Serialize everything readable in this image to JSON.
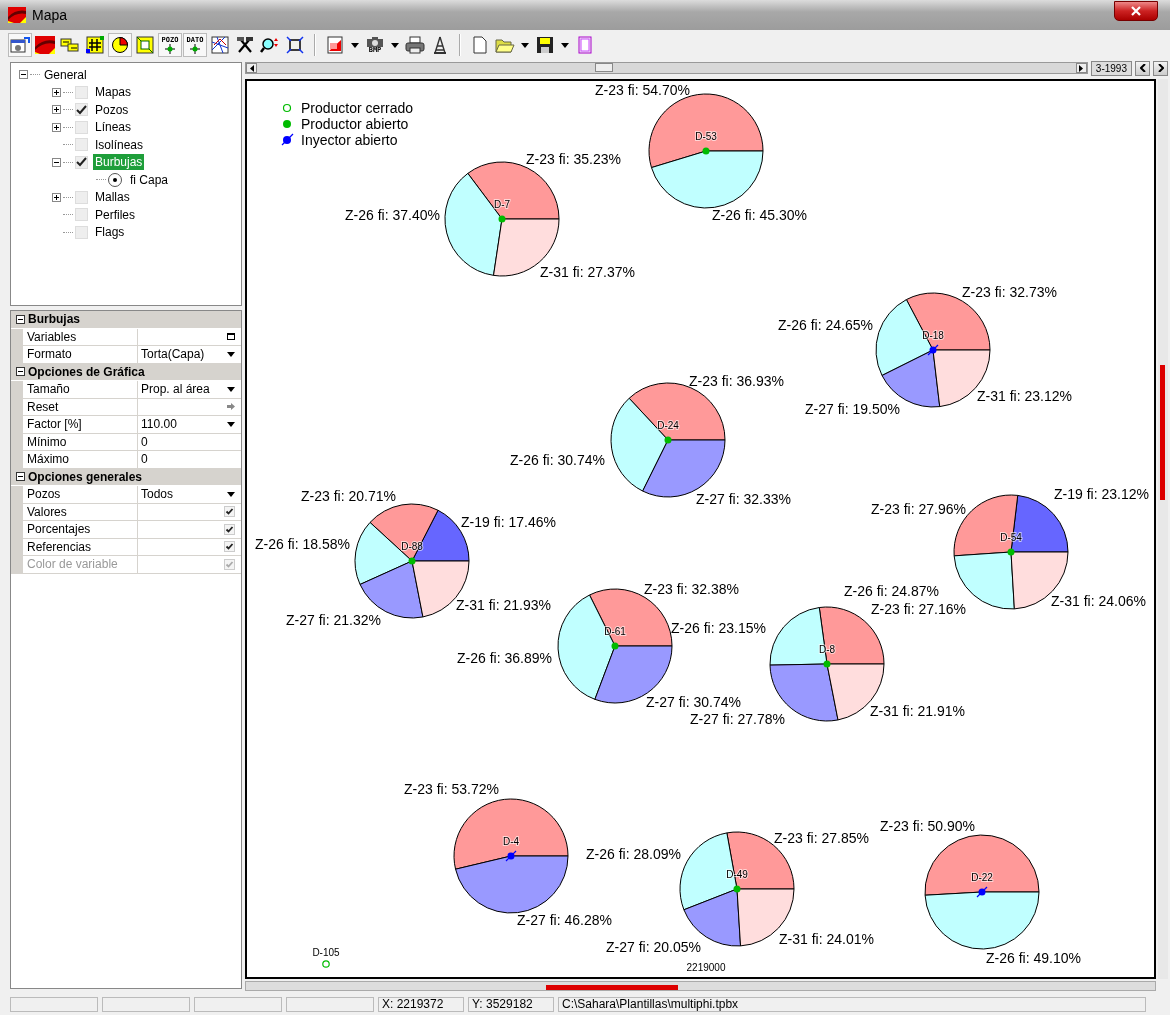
{
  "window": {
    "title": "Mapa"
  },
  "toolbar": {
    "groups": [
      [
        {
          "kind": "properties",
          "pressed": true
        },
        {
          "kind": "layers",
          "pressed": false
        },
        {
          "kind": "swap",
          "pressed": false
        },
        {
          "kind": "grid",
          "pressed": false
        },
        {
          "kind": "pie",
          "pressed": true
        },
        {
          "kind": "fit",
          "pressed": false
        },
        {
          "kind": "well",
          "caption": "POZO",
          "pressed": true
        },
        {
          "kind": "well",
          "caption": "DATO",
          "pressed": true
        },
        {
          "kind": "network",
          "pressed": false
        },
        {
          "kind": "tools",
          "pressed": false
        },
        {
          "kind": "zoom",
          "pressed": false
        },
        {
          "kind": "fullscreen",
          "pressed": false
        }
      ],
      [
        {
          "kind": "export",
          "dropdown": true,
          "pressed": false
        },
        {
          "kind": "camera",
          "caption": "BMP",
          "dropdown": true,
          "pressed": false
        },
        {
          "kind": "printer",
          "pressed": false
        },
        {
          "kind": "derrick",
          "pressed": false
        }
      ],
      [
        {
          "kind": "new",
          "pressed": false
        },
        {
          "kind": "open",
          "dropdown": true,
          "pressed": false
        },
        {
          "kind": "save",
          "dropdown": true,
          "pressed": false
        },
        {
          "kind": "book",
          "pressed": false
        }
      ]
    ]
  },
  "tree": {
    "items": [
      {
        "label": "General",
        "expanded": true,
        "selected": false,
        "children": [
          {
            "label": "Mapas",
            "kind": "checkbox",
            "checked": false,
            "expanded": false,
            "selected": false
          },
          {
            "label": "Pozos",
            "kind": "checkbox",
            "checked": true,
            "expanded": false,
            "selected": false
          },
          {
            "label": "Líneas",
            "kind": "checkbox",
            "checked": false,
            "expanded": false,
            "selected": false
          },
          {
            "label": "Isolíneas",
            "kind": "checkbox",
            "checked": false,
            "selected": false
          },
          {
            "label": "Burbujas",
            "kind": "checkbox",
            "checked": true,
            "expanded": true,
            "selected": true,
            "children": [
              {
                "label": "fi Capa",
                "kind": "radio",
                "checked": true,
                "selected": false
              }
            ]
          },
          {
            "label": "Mallas",
            "kind": "checkbox",
            "checked": false,
            "expanded": false,
            "selected": false
          },
          {
            "label": "Perfiles",
            "kind": "checkbox",
            "checked": false,
            "selected": false
          },
          {
            "label": "Flags",
            "kind": "checkbox",
            "checked": false,
            "selected": false
          }
        ]
      }
    ]
  },
  "properties": {
    "sections": [
      {
        "title": "Burbujas",
        "expanded": true,
        "rows": [
          {
            "name": "Variables",
            "kind": "dialog",
            "disabled": false
          },
          {
            "name": "Formato",
            "value": "Torta(Capa)",
            "kind": "dropdown",
            "disabled": false
          }
        ]
      },
      {
        "title": "Opciones de Gráfica",
        "expanded": true,
        "rows": [
          {
            "name": "Tamaño",
            "value": "Prop. al área",
            "kind": "dropdown",
            "disabled": false
          },
          {
            "name": "Reset",
            "kind": "action",
            "disabled": false
          },
          {
            "name": "Factor [%]",
            "value": "110.00",
            "kind": "dropdown",
            "disabled": false
          },
          {
            "name": "Mínimo",
            "value": "0",
            "kind": "text",
            "disabled": false
          },
          {
            "name": "Máximo",
            "value": "0",
            "kind": "text",
            "disabled": false
          }
        ]
      },
      {
        "title": "Opciones generales",
        "expanded": true,
        "rows": [
          {
            "name": "Pozos",
            "value": "Todos",
            "kind": "dropdown",
            "disabled": false
          },
          {
            "name": "Valores",
            "kind": "checkbox",
            "checked": true,
            "disabled": false
          },
          {
            "name": "Porcentajes",
            "kind": "checkbox",
            "checked": true,
            "disabled": false
          },
          {
            "name": "Referencias",
            "kind": "checkbox",
            "checked": true,
            "disabled": false
          },
          {
            "name": "Color de variable",
            "kind": "checkbox",
            "checked": true,
            "disabled": true
          }
        ]
      }
    ]
  },
  "map": {
    "date": "3-1993",
    "legend": [
      {
        "kind": "producer_closed",
        "label": "Productor cerrado"
      },
      {
        "kind": "producer_open",
        "label": "Productor abierto"
      },
      {
        "kind": "injector_open",
        "label": "Inyector abierto"
      }
    ],
    "wells": [
      {
        "name": "D-53",
        "kind": "producer_open",
        "slices": [
          {
            "layer": "Z-23 fi:",
            "value": "54.70%",
            "color": "#ff9999"
          },
          {
            "layer": "Z-26 fi:",
            "value": "45.30%",
            "color": "#c0ffff"
          }
        ]
      },
      {
        "name": "D-7",
        "kind": "producer_open",
        "slices": [
          {
            "layer": "Z-23 fi:",
            "value": "35.23%",
            "color": "#ff9999"
          },
          {
            "layer": "Z-26 fi:",
            "value": "37.40%",
            "color": "#c0ffff"
          },
          {
            "layer": "Z-31 fi:",
            "value": "27.37%",
            "color": "#ffdddd"
          }
        ]
      },
      {
        "name": "D-18",
        "kind": "injector_open",
        "slices": [
          {
            "layer": "Z-23 fi:",
            "value": "32.73%",
            "color": "#ff9999"
          },
          {
            "layer": "Z-26 fi:",
            "value": "24.65%",
            "color": "#c0ffff"
          },
          {
            "layer": "Z-27 fi:",
            "value": "19.50%",
            "color": "#9999ff"
          },
          {
            "layer": "Z-31 fi:",
            "value": "23.12%",
            "color": "#ffdddd"
          }
        ]
      },
      {
        "name": "D-24",
        "kind": "producer_open",
        "slices": [
          {
            "layer": "Z-23 fi:",
            "value": "36.93%",
            "color": "#ff9999"
          },
          {
            "layer": "Z-26 fi:",
            "value": "30.74%",
            "color": "#c0ffff"
          },
          {
            "layer": "Z-27 fi:",
            "value": "32.33%",
            "color": "#9999ff"
          }
        ]
      },
      {
        "name": "D-88",
        "kind": "producer_open",
        "slices": [
          {
            "layer": "Z-19 fi:",
            "value": "17.46%",
            "color": "#6666ff"
          },
          {
            "layer": "Z-23 fi:",
            "value": "20.71%",
            "color": "#ff9999"
          },
          {
            "layer": "Z-26 fi:",
            "value": "18.58%",
            "color": "#c0ffff"
          },
          {
            "layer": "Z-27 fi:",
            "value": "21.32%",
            "color": "#9999ff"
          },
          {
            "layer": "Z-31 fi:",
            "value": "21.93%",
            "color": "#ffdddd"
          }
        ]
      },
      {
        "name": "D-54",
        "kind": "producer_open",
        "slices": [
          {
            "layer": "Z-19 fi:",
            "value": "23.12%",
            "color": "#6666ff"
          },
          {
            "layer": "Z-23 fi:",
            "value": "27.96%",
            "color": "#ff9999"
          },
          {
            "layer": "Z-26 fi:",
            "value": "24.87%",
            "color": "#c0ffff"
          },
          {
            "layer": "Z-31 fi:",
            "value": "24.06%",
            "color": "#ffdddd"
          }
        ]
      },
      {
        "name": "D-61",
        "kind": "producer_open",
        "slices": [
          {
            "layer": "Z-23 fi:",
            "value": "32.38%",
            "color": "#ff9999"
          },
          {
            "layer": "Z-26 fi:",
            "value": "36.89%",
            "color": "#c0ffff"
          },
          {
            "layer": "Z-27 fi:",
            "value": "30.74%",
            "color": "#9999ff"
          }
        ]
      },
      {
        "name": "D-8",
        "kind": "producer_open",
        "slices": [
          {
            "layer": "Z-23 fi:",
            "value": "27.16%",
            "color": "#ff9999"
          },
          {
            "layer": "Z-26 fi:",
            "value": "23.15%",
            "color": "#c0ffff"
          },
          {
            "layer": "Z-27 fi:",
            "value": "27.78%",
            "color": "#9999ff"
          },
          {
            "layer": "Z-31 fi:",
            "value": "21.91%",
            "color": "#ffdddd"
          }
        ]
      },
      {
        "name": "D-4",
        "kind": "injector_open",
        "slices": [
          {
            "layer": "Z-23 fi:",
            "value": "53.72%",
            "color": "#ff9999"
          },
          {
            "layer": "Z-27 fi:",
            "value": "46.28%",
            "color": "#9999ff"
          }
        ]
      },
      {
        "name": "D-49",
        "kind": "producer_open",
        "slices": [
          {
            "layer": "Z-23 fi:",
            "value": "27.85%",
            "color": "#ff9999"
          },
          {
            "layer": "Z-26 fi:",
            "value": "28.09%",
            "color": "#c0ffff"
          },
          {
            "layer": "Z-27 fi:",
            "value": "20.05%",
            "color": "#9999ff"
          },
          {
            "layer": "Z-31 fi:",
            "value": "24.01%",
            "color": "#ffdddd"
          }
        ]
      },
      {
        "name": "D-22",
        "kind": "injector_open",
        "slices": [
          {
            "layer": "Z-23 fi:",
            "value": "50.90%",
            "color": "#ff9999"
          },
          {
            "layer": "Z-26 fi:",
            "value": "49.10%",
            "color": "#c0ffff"
          }
        ]
      },
      {
        "name": "D-105",
        "kind": "producer_closed"
      }
    ],
    "grid_labels": [
      "2219000"
    ]
  },
  "status_bar": {
    "x": "X: 2219372",
    "y": "Y: 3529182",
    "file": "C:\\Sahara\\Plantillas\\multiphi.tpbx"
  }
}
